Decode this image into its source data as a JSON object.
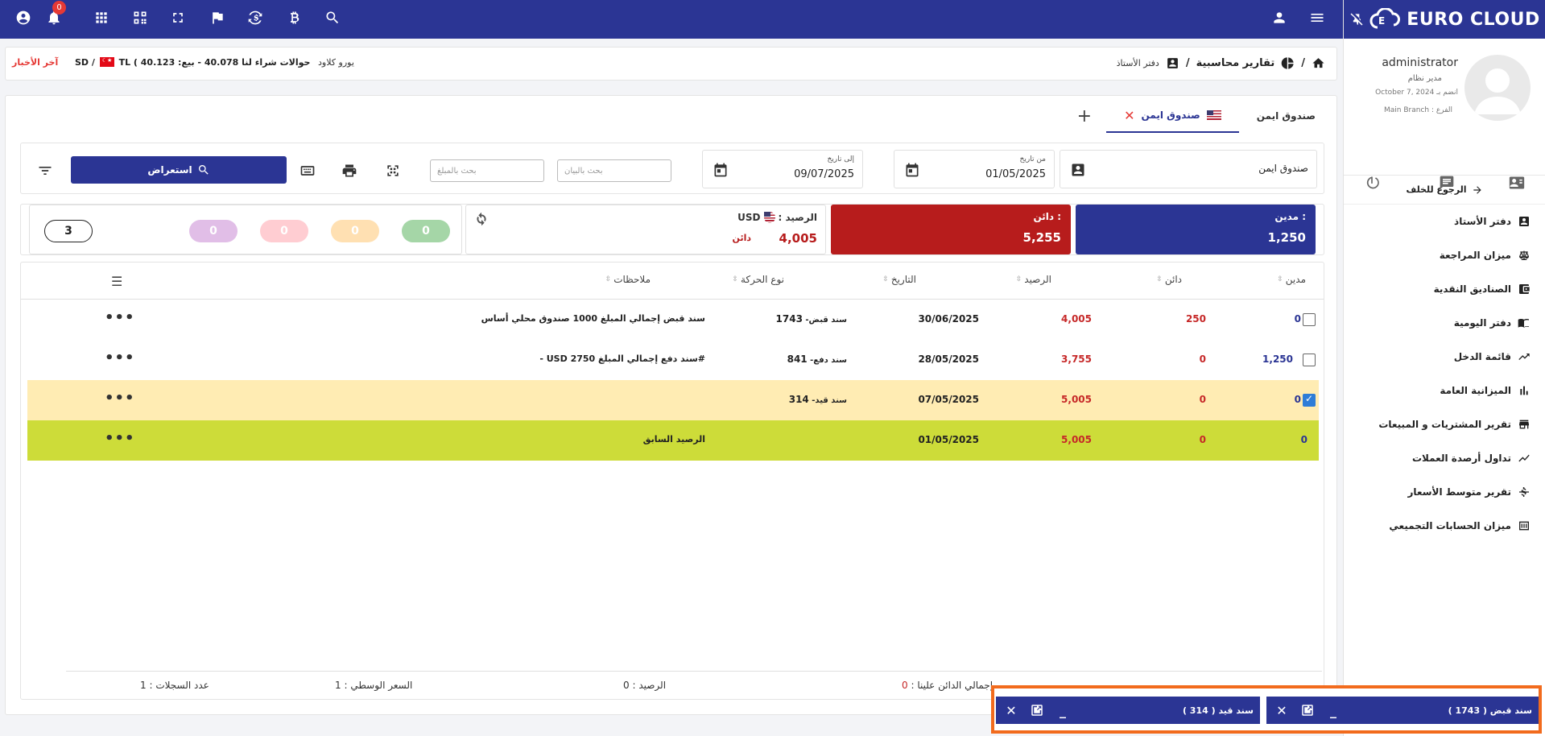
{
  "topbar": {
    "notifications_count": "0",
    "icons": [
      "account-circle-icon",
      "bell-icon",
      "apps-grid-icon",
      "qr-code-icon",
      "fullscreen-icon",
      "flag-icon",
      "currency-exchange-icon",
      "bitcoin-icon",
      "search-icon",
      "person-icon",
      "hamburger-menu-icon"
    ]
  },
  "brand": {
    "name": "EURO CLOUD"
  },
  "user": {
    "name": "administrator",
    "role": "مدير نظام",
    "joined": "انضم بـ October 7, 2024",
    "branch": "الفرع : Main Branch"
  },
  "sidebar": {
    "back_label": "الرجوع للخلف",
    "items": [
      {
        "label": "دفتر الأستاذ",
        "icon": "ledger-icon"
      },
      {
        "label": "ميزان المراجعة",
        "icon": "scale-icon"
      },
      {
        "label": "الصناديق النقدية",
        "icon": "wallet-icon"
      },
      {
        "label": "دفتر اليومية",
        "icon": "book-icon"
      },
      {
        "label": "قائمة الدخل",
        "icon": "trend-icon"
      },
      {
        "label": "الميزانية العامة",
        "icon": "bar-chart-icon"
      },
      {
        "label": "تقرير المشتريات و المبيعات",
        "icon": "store-icon"
      },
      {
        "label": "تداول أرصدة العملات",
        "icon": "line-chart-icon"
      },
      {
        "label": "تقرير متوسط الأسعار",
        "icon": "dollar-slash-icon"
      },
      {
        "label": "ميزان الحسابات التجميعي",
        "icon": "summary-icon"
      }
    ]
  },
  "breadcrumb": {
    "section": "تقارير محاسبية",
    "page": "دفتر الأستاذ",
    "separator": "/"
  },
  "ticker": {
    "news_label": "آخر الأخبار",
    "text_left": "SD / ",
    "text_right": "TL ( 40.123 :حوالات شراء لنا 40.078 - بيع",
    "source": "يورو كلاود"
  },
  "tabs": {
    "items": [
      {
        "label": "صندوق ايمن"
      },
      {
        "label": "صندوق ايمن"
      }
    ],
    "add_label": "+"
  },
  "filters": {
    "account_value": "صندوق ايمن",
    "from_label": "من تاريخ",
    "from_value": "01/05/2025",
    "to_label": "إلى تاريخ",
    "to_value": "09/07/2025",
    "search_statement_placeholder": "بحث بالبيان",
    "search_amount_placeholder": "بحث بالمبلغ",
    "show_button": "استعراض"
  },
  "summary": {
    "debit_label": "مدين :",
    "debit_value": "1,250",
    "credit_label": "دائن :",
    "credit_value": "5,255",
    "balance_label": "الرصيد :",
    "balance_currency": "USD",
    "balance_value": "4,005",
    "balance_type": "دائن",
    "pills": [
      {
        "value": "0",
        "color": "#a5d6a7"
      },
      {
        "value": "0",
        "color": "#ffe0b2"
      },
      {
        "value": "0",
        "color": "#ffcdd2"
      },
      {
        "value": "0",
        "color": "#e1bee7"
      }
    ],
    "count": "3"
  },
  "table": {
    "columns": [
      "مدين",
      "دائن",
      "الرصيد",
      "التاريخ",
      "نوع الحركة",
      "ملاحظات"
    ],
    "rows": [
      {
        "debit": "0",
        "credit": "250",
        "balance": "4,005",
        "date": "30/06/2025",
        "type_prefix": "سند قبض- ",
        "type_no": "1743",
        "notes": "سند قبض إجمالي المبلغ 1000 صندوق محلي أساس",
        "checked": false,
        "style": "normal"
      },
      {
        "debit": "1,250",
        "credit": "0",
        "balance": "3,755",
        "date": "28/05/2025",
        "type_prefix": "سند دفع- ",
        "type_no": "841",
        "notes": "#سند دفع إجمالي المبلغ 2750 USD -",
        "checked": false,
        "style": "normal"
      },
      {
        "debit": "0",
        "credit": "0",
        "balance": "5,005",
        "date": "07/05/2025",
        "type_prefix": "سند قيد- ",
        "type_no": "314",
        "notes": "",
        "checked": true,
        "style": "highlight"
      },
      {
        "debit": "0",
        "credit": "0",
        "balance": "5,005",
        "date": "01/05/2025",
        "type_prefix": "",
        "type_no": "",
        "notes": "الرصيد السابق",
        "checked": false,
        "style": "opening"
      }
    ],
    "row_colors": {
      "highlight": "#ffecb3",
      "opening": "#cddc39"
    }
  },
  "footer": {
    "records": "عدد السجلات : 1",
    "middle_rate": "السعر الوسطي : 1",
    "balance": "الرصيد : 0",
    "total_credit_label": "إجمالي الدائن علينا : ",
    "total_credit_value": "0"
  },
  "minimized": [
    {
      "title": "سند قبض ( 1743 )"
    },
    {
      "title": "سند قيد ( 314 )"
    }
  ]
}
